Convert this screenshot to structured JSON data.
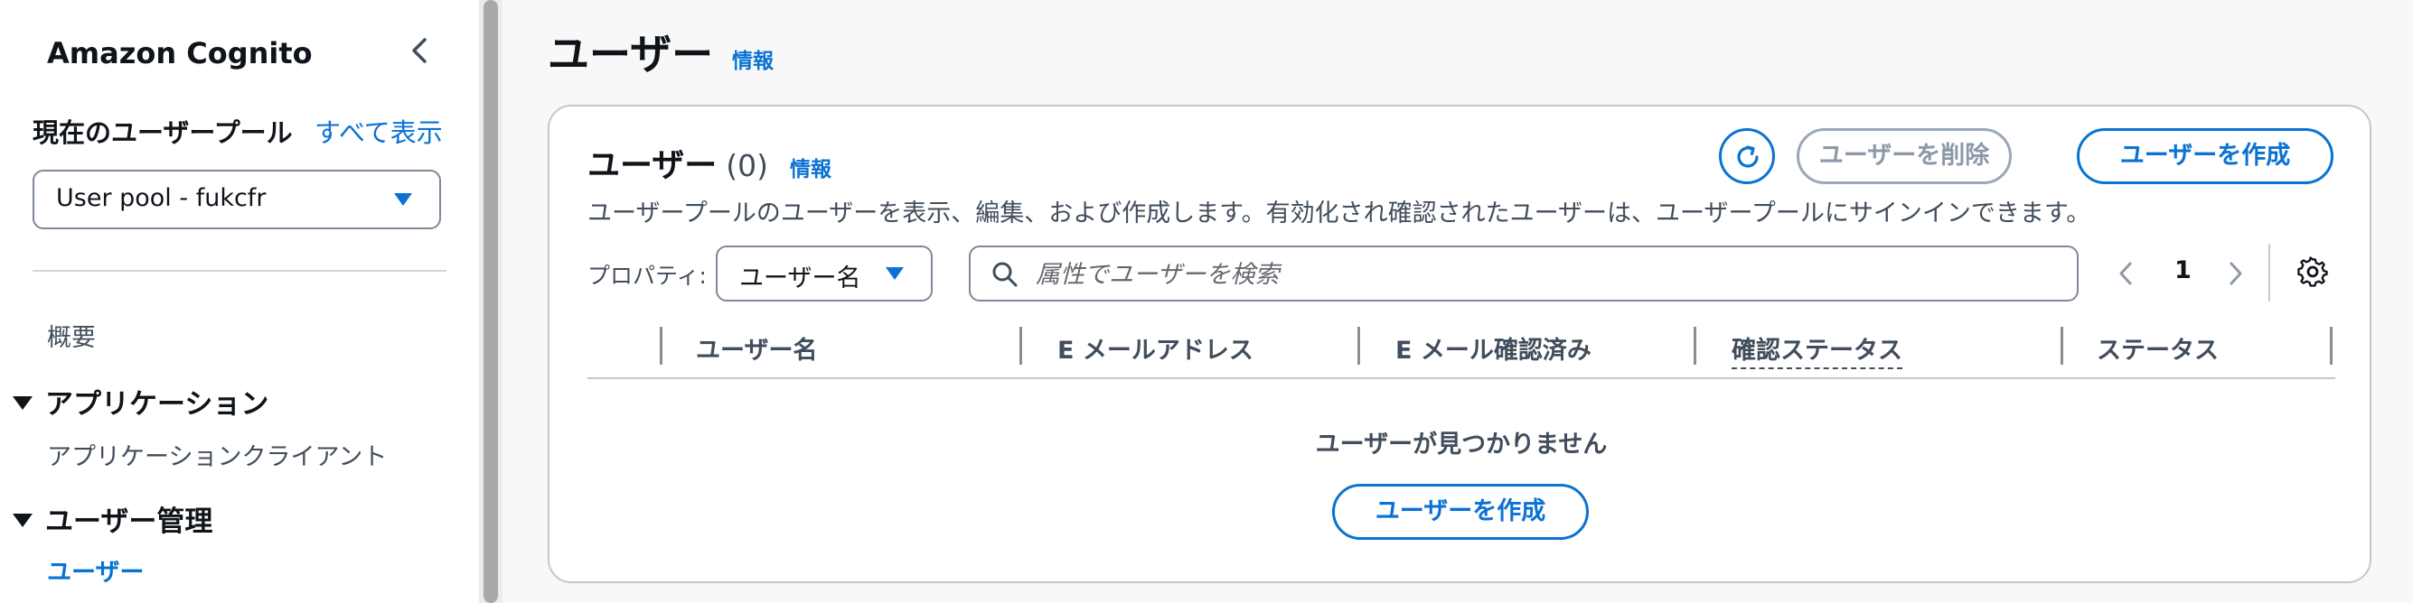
{
  "sidebar": {
    "title": "Amazon Cognito",
    "pool_label": "現在のユーザープール",
    "view_all": "すべて表示",
    "pool_select": "User pool - fukcfr",
    "overview": "概要",
    "sections": [
      {
        "label": "アプリケーション",
        "items": [
          "アプリケーションクライアント"
        ]
      },
      {
        "label": "ユーザー管理",
        "items": [
          "ユーザー"
        ]
      }
    ]
  },
  "page": {
    "title": "ユーザー",
    "info": "情報"
  },
  "card": {
    "title": "ユーザー",
    "count": "(0)",
    "info": "情報",
    "description": "ユーザープールのユーザーを表示、編集、および作成します。有効化され確認されたユーザーは、ユーザープールにサインインできます。",
    "delete_button": "ユーザーを削除",
    "create_button": "ユーザーを作成",
    "property_label": "プロパティ:",
    "property_select": "ユーザー名",
    "search_placeholder": "属性でユーザーを検索",
    "page_number": "1",
    "columns": [
      "ユーザー名",
      "E メールアドレス",
      "E メール確認済み",
      "確認ステータス",
      "ステータス"
    ],
    "empty_text": "ユーザーが見つかりません",
    "empty_create_button": "ユーザーを作成"
  },
  "colors": {
    "accent": "#0972d3",
    "text": "#0f141a",
    "muted": "#414d5c"
  }
}
